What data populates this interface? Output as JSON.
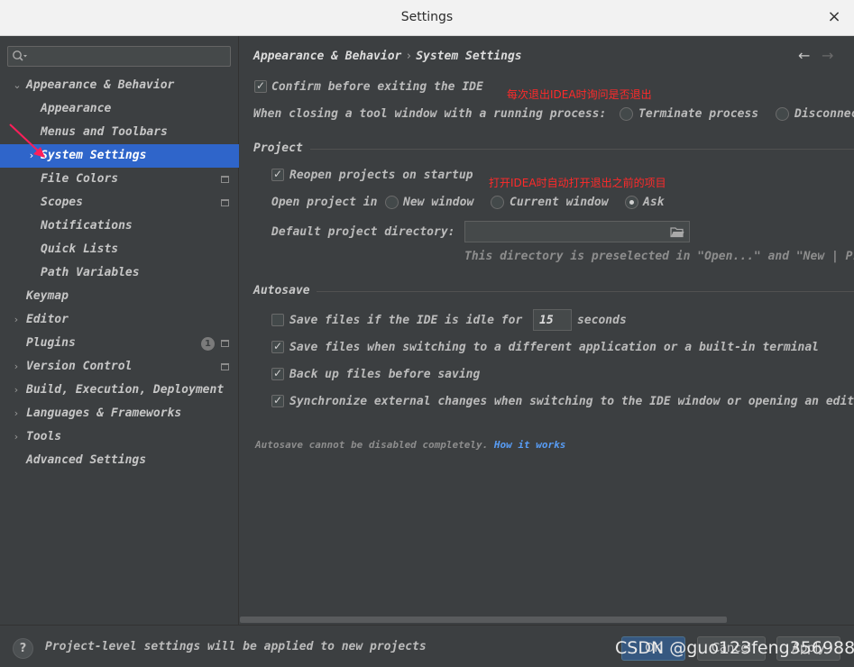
{
  "window": {
    "title": "Settings",
    "close_glyph": "×"
  },
  "sidebar": {
    "search_placeholder": "",
    "items": [
      {
        "label": "Appearance & Behavior",
        "expanded": true
      },
      {
        "label": "Appearance"
      },
      {
        "label": "Menus and Toolbars"
      },
      {
        "label": "System Settings",
        "selected": true
      },
      {
        "label": "File Colors"
      },
      {
        "label": "Scopes"
      },
      {
        "label": "Notifications"
      },
      {
        "label": "Quick Lists"
      },
      {
        "label": "Path Variables"
      },
      {
        "label": "Keymap"
      },
      {
        "label": "Editor"
      },
      {
        "label": "Plugins",
        "badge": "1"
      },
      {
        "label": "Version Control"
      },
      {
        "label": "Build, Execution, Deployment"
      },
      {
        "label": "Languages & Frameworks"
      },
      {
        "label": "Tools"
      },
      {
        "label": "Advanced Settings"
      }
    ]
  },
  "content": {
    "breadcrumb": {
      "parent": "Appearance & Behavior",
      "sep": "›",
      "current": "System Settings"
    },
    "nav": {
      "back": "←",
      "forward": "→"
    },
    "confirm_exit": {
      "label": "Confirm before exiting the IDE",
      "checked": true
    },
    "closing_window": {
      "label": "When closing a tool window with a running process:",
      "options": [
        "Terminate process",
        "Disconnect"
      ]
    },
    "project": {
      "header": "Project",
      "reopen": {
        "label": "Reopen projects on startup",
        "checked": true
      },
      "open_in": {
        "label": "Open project in",
        "options": [
          "New window",
          "Current window",
          "Ask"
        ],
        "selected": "Ask"
      },
      "default_dir": {
        "label": "Default project directory:",
        "value": "",
        "hint": "This directory is preselected in \"Open...\" and \"New | Project...\" dialogs."
      }
    },
    "autosave": {
      "header": "Autosave",
      "idle": {
        "label_before": "Save files if the IDE is idle for",
        "value": "15",
        "label_after": "seconds",
        "checked": false
      },
      "switching": {
        "label": "Save files when switching to a different application or a built-in terminal",
        "checked": true
      },
      "backup": {
        "label": "Back up files before saving",
        "checked": true
      },
      "sync": {
        "label": "Synchronize external changes when switching to the IDE window or opening an editor",
        "checked": true
      },
      "note": "Autosave cannot be disabled completely.",
      "link": "How it works"
    },
    "annotations": {
      "exit_note": "每次退出IDEA时询问是否退出",
      "reopen_note": "打开IDEA时自动打开退出之前的项目"
    }
  },
  "footer": {
    "help": "?",
    "message": "Project-level settings will be applied to new projects",
    "buttons": {
      "ok": "OK",
      "cancel": "Cancel",
      "apply": "Apply"
    }
  },
  "watermark": "CSDN @guo123feng356988",
  "colors": {
    "selected": "#2f65ca",
    "annotation": "#ff2a2a",
    "link": "#589df6",
    "arrow": "#ff1f5a"
  }
}
